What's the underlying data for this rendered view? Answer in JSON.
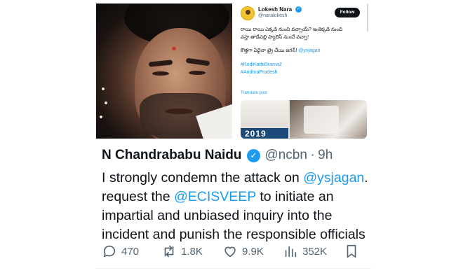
{
  "top_tweet": {
    "name": "Lokesh Nara",
    "handle": "@naralokesh",
    "follow_label": "Follow",
    "line1": "రాయి రాయి ఎక్కడి నుంచి వచ్చాయ్? ఇంకెక్కడి నుంచి",
    "line2": "వస్తా తాడేపల్లి ప్యాలెస్ నుంచే వచ్చా!",
    "line3_text": "కొత్తగా ఏదైనా ట్రై చేయి జగన్! ",
    "line3_mention": "@ysjagan",
    "hashtag1": "#KodiKathiDrama2",
    "hashtag2": "#AndhraPradesh",
    "translate_label": "Translate post",
    "media_year": "2019"
  },
  "main_tweet": {
    "name": "N Chandrababu Naidu",
    "handle": "@ncbn",
    "separator": "·",
    "time": "9h",
    "line1_text": "I strongly condemn the attack on ",
    "line1_mention": "@ysjagan",
    "line1_end": ".",
    "line2_text": "request the ",
    "line2_mention": "@ECISVEEP",
    "line2_end": " to initiate an",
    "line3": "impartial and unbiased inquiry into the",
    "line4": "incident and punish the responsible officials"
  },
  "actions": {
    "replies": "470",
    "reposts": "1.8K",
    "likes": "9.9K",
    "views": "352K"
  },
  "colors": {
    "accent": "#1d9bf0",
    "text": "#0f1419",
    "muted": "#536471"
  }
}
